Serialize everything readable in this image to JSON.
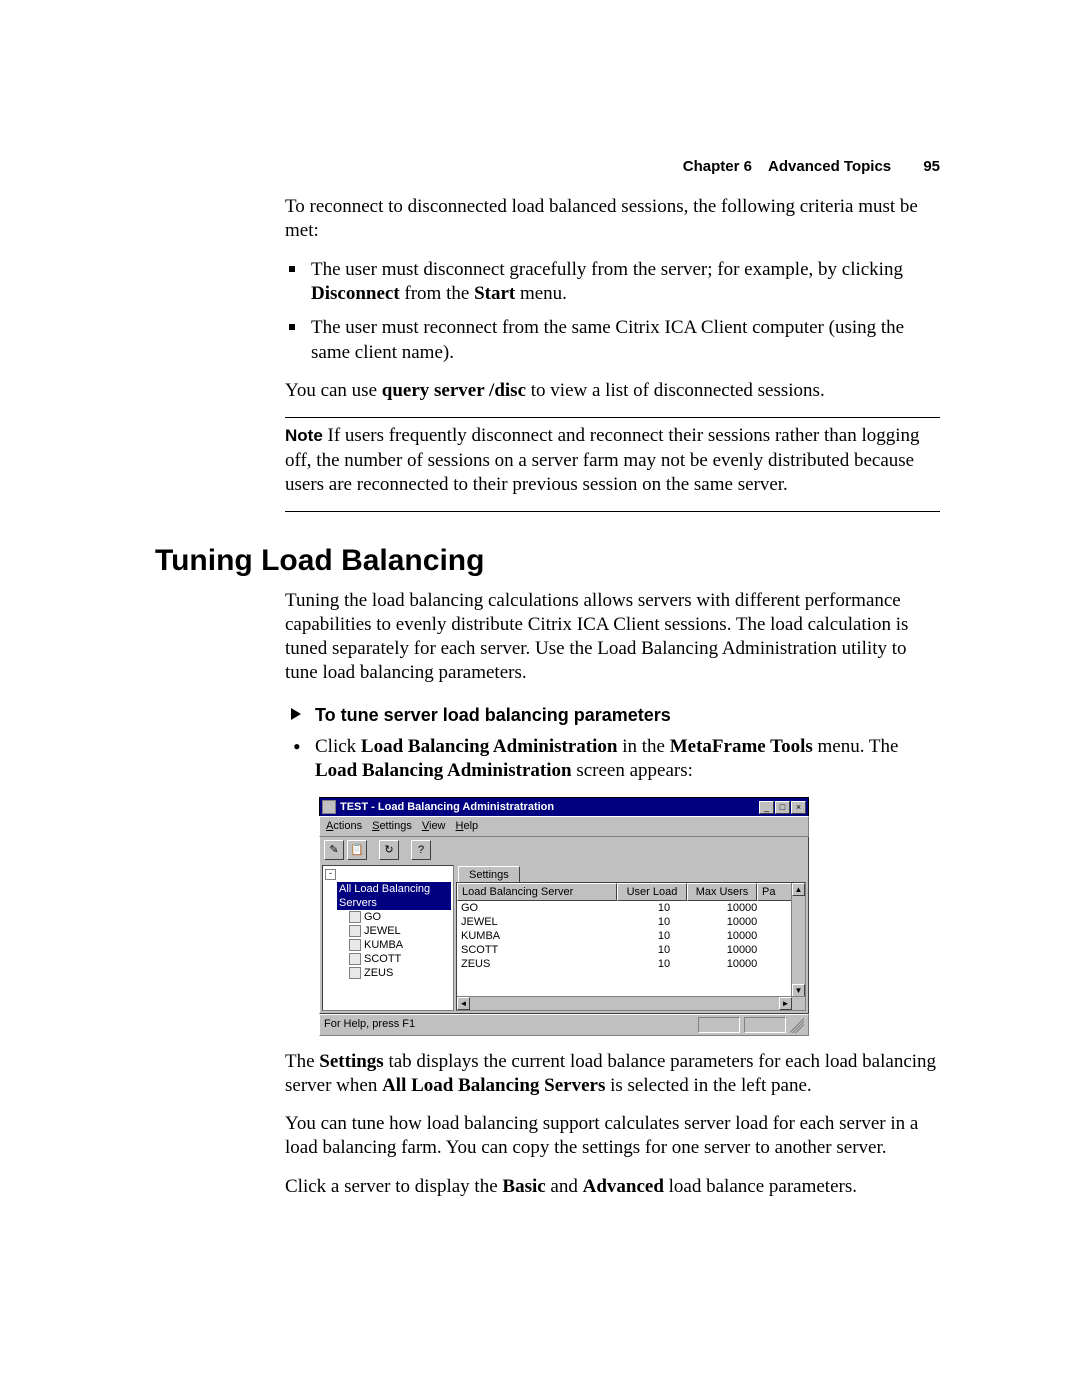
{
  "header": {
    "chapter_label": "Chapter 6",
    "chapter_title": "Advanced Topics",
    "page_number": "95"
  },
  "intro_para": "To reconnect to disconnected load balanced sessions, the following criteria must be met:",
  "criteria": [
    {
      "pre": "The user must disconnect gracefully from the server; for example, by clicking ",
      "b1": "Disconnect",
      "mid": " from the ",
      "b2": "Start",
      "post": " menu."
    },
    {
      "pre": "The user must reconnect from the same Citrix ICA Client computer (using the same client name).",
      "b1": "",
      "mid": "",
      "b2": "",
      "post": ""
    }
  ],
  "query_para": {
    "pre": "You can use ",
    "cmd": "query server /disc",
    "post": " to view a list of disconnected sessions."
  },
  "note": {
    "label": "Note",
    "text": "  If users frequently disconnect and reconnect their sessions rather than logging off, the number of sessions on a server farm may not be evenly distributed because users are reconnected to their previous session on the same server."
  },
  "section_heading": "Tuning Load Balancing",
  "tuning_para": "Tuning the load balancing calculations allows servers with different performance capabilities to evenly distribute Citrix ICA Client sessions. The load calculation is tuned separately for each server. Use the Load Balancing Administration utility to tune load balancing parameters.",
  "proc_heading": "To tune server load balancing parameters",
  "proc_step": {
    "pre": "Click ",
    "b1": "Load Balancing Administration",
    "mid": " in the ",
    "b2": "MetaFrame Tools",
    "mid2": " menu. The ",
    "b3": "Load Balancing Administration",
    "post": " screen appears:"
  },
  "after1": {
    "pre": "The ",
    "b1": "Settings",
    "mid": " tab displays the current load balance parameters for each load balancing server when ",
    "b2": "All Load Balancing Servers",
    "post": " is selected in the left pane."
  },
  "after2": "You can tune how load balancing support calculates server load for each server in a load balancing farm. You can copy the settings for one server to another server.",
  "after3": {
    "pre": "Click a server to display the ",
    "b1": "Basic",
    "mid": " and ",
    "b2": "Advanced",
    "post": " load balance parameters."
  },
  "win": {
    "title": "TEST - Load Balancing Administratration",
    "minimize": "_",
    "maximize": "□",
    "close": "×",
    "menu": {
      "actions": "Actions",
      "settings": "Settings",
      "view": "View",
      "help": "Help"
    },
    "toolbar": {
      "b1": "✎",
      "b2": "📋",
      "b3": "↻",
      "b4": "?"
    },
    "tree": {
      "root": "All Load Balancing Servers",
      "items": [
        "GO",
        "JEWEL",
        "KUMBA",
        "SCOTT",
        "ZEUS"
      ]
    },
    "tab": "Settings",
    "columns": {
      "server": "Load Balancing Server",
      "userload": "User Load",
      "maxusers": "Max Users",
      "pa": "Pa"
    },
    "rows": [
      {
        "server": "GO",
        "userload": "10",
        "maxusers": "10000"
      },
      {
        "server": "JEWEL",
        "userload": "10",
        "maxusers": "10000"
      },
      {
        "server": "KUMBA",
        "userload": "10",
        "maxusers": "10000"
      },
      {
        "server": "SCOTT",
        "userload": "10",
        "maxusers": "10000"
      },
      {
        "server": "ZEUS",
        "userload": "10",
        "maxusers": "10000"
      }
    ],
    "status": "For Help, press F1"
  }
}
